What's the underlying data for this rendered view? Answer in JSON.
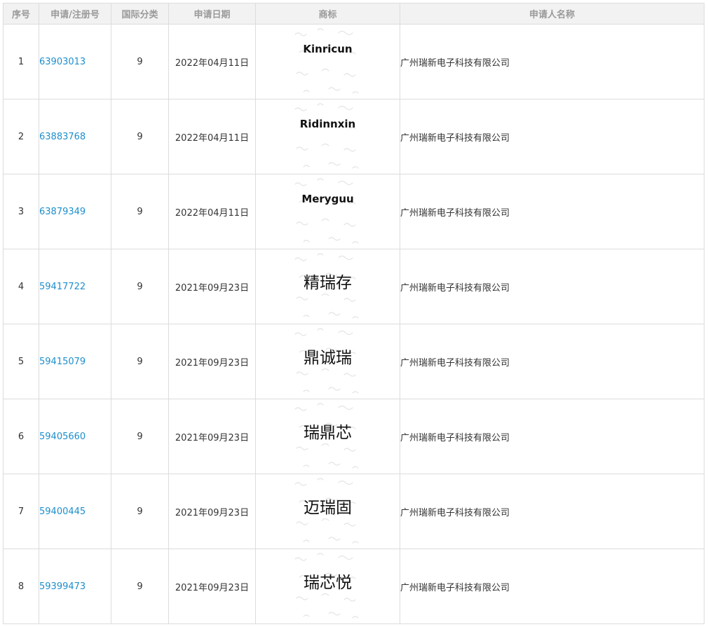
{
  "table": {
    "columns": [
      "序号",
      "申请/注册号",
      "国际分类",
      "申请日期",
      "商标",
      "申请人名称"
    ],
    "rows": [
      {
        "no": "1",
        "reg_no": "63903013",
        "class": "9",
        "date": "2022年04月11日",
        "mark": "Kinricun",
        "mark_kind": "latin",
        "owner": "广州瑞新电子科技有限公司"
      },
      {
        "no": "2",
        "reg_no": "63883768",
        "class": "9",
        "date": "2022年04月11日",
        "mark": "Ridinnxin",
        "mark_kind": "latin",
        "owner": "广州瑞新电子科技有限公司"
      },
      {
        "no": "3",
        "reg_no": "63879349",
        "class": "9",
        "date": "2022年04月11日",
        "mark": "Meryguu",
        "mark_kind": "latin",
        "owner": "广州瑞新电子科技有限公司"
      },
      {
        "no": "4",
        "reg_no": "59417722",
        "class": "9",
        "date": "2021年09月23日",
        "mark": "精瑞存",
        "mark_kind": "cjk",
        "owner": "广州瑞新电子科技有限公司"
      },
      {
        "no": "5",
        "reg_no": "59415079",
        "class": "9",
        "date": "2021年09月23日",
        "mark": "鼎诚瑞",
        "mark_kind": "cjk",
        "owner": "广州瑞新电子科技有限公司"
      },
      {
        "no": "6",
        "reg_no": "59405660",
        "class": "9",
        "date": "2021年09月23日",
        "mark": "瑞鼎芯",
        "mark_kind": "cjk",
        "owner": "广州瑞新电子科技有限公司"
      },
      {
        "no": "7",
        "reg_no": "59400445",
        "class": "9",
        "date": "2021年09月23日",
        "mark": "迈瑞固",
        "mark_kind": "cjk",
        "owner": "广州瑞新电子科技有限公司"
      },
      {
        "no": "8",
        "reg_no": "59399473",
        "class": "9",
        "date": "2021年09月23日",
        "mark": "瑞芯悦",
        "mark_kind": "cjk",
        "owner": "广州瑞新电子科技有限公司"
      }
    ]
  },
  "colors": {
    "link": "#1d8fcd",
    "header_bg": "#f2f2f2",
    "header_text": "#9a9a9a",
    "border": "#dcdcdc"
  }
}
